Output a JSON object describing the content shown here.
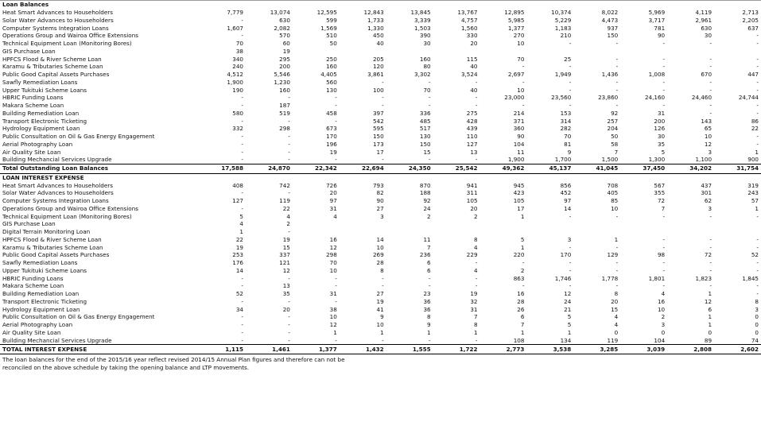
{
  "sections": [
    {
      "title": "Loan Balances",
      "rows": [
        {
          "label": "Heat Smart Advances to Householders",
          "values": [
            "7,779",
            "13,074",
            "12,595",
            "12,843",
            "13,845",
            "13,767",
            "12,895",
            "10,374",
            "8,022",
            "5,969",
            "4,119",
            "2,713"
          ]
        },
        {
          "label": "Solar Water Advances to Householders",
          "values": [
            "-",
            "630",
            "599",
            "1,733",
            "3,339",
            "4,757",
            "5,985",
            "5,229",
            "4,473",
            "3,717",
            "2,961",
            "2,205"
          ]
        },
        {
          "label": "Computer Systems Integration Loans",
          "values": [
            "1,607",
            "2,082",
            "1,569",
            "1,330",
            "1,503",
            "1,560",
            "1,377",
            "1,183",
            "937",
            "781",
            "630",
            "637"
          ]
        },
        {
          "label": "Operations Group and Wairoa Office Extensions",
          "values": [
            "-",
            "570",
            "510",
            "450",
            "390",
            "330",
            "270",
            "210",
            "150",
            "90",
            "30",
            "-"
          ]
        },
        {
          "label": "Technical Equipment Loan (Monitoring Bores)",
          "values": [
            "70",
            "60",
            "50",
            "40",
            "30",
            "20",
            "10",
            "-",
            "-",
            "-",
            "-",
            "-"
          ]
        },
        {
          "label": "GIS Purchase Loan",
          "values": [
            "38",
            "19",
            "",
            "",
            "",
            "",
            "",
            "",
            "",
            "",
            "",
            ""
          ]
        },
        {
          "label": "HPFCS Flood & River Scheme Loan",
          "values": [
            "340",
            "295",
            "250",
            "205",
            "160",
            "115",
            "70",
            "25",
            "-",
            "-",
            "-",
            "-"
          ]
        },
        {
          "label": "Karamu & Tributaries Scheme Loan",
          "values": [
            "240",
            "200",
            "160",
            "120",
            "80",
            "40",
            "-",
            "-",
            "-",
            "-",
            "-",
            "-"
          ]
        },
        {
          "label": "Public Good Capital Assets Purchases",
          "values": [
            "4,512",
            "5,546",
            "4,405",
            "3,861",
            "3,302",
            "3,524",
            "2,697",
            "1,949",
            "1,436",
            "1,008",
            "670",
            "447"
          ]
        },
        {
          "label": "Sawfly Remediation Loans",
          "values": [
            "1,900",
            "1,230",
            "560",
            "-",
            "-",
            "-",
            "-",
            "-",
            "-",
            "-",
            "-",
            "-"
          ]
        },
        {
          "label": "Upper Tukituki Scheme Loans",
          "values": [
            "190",
            "160",
            "130",
            "100",
            "70",
            "40",
            "10",
            "-",
            "-",
            "-",
            "-",
            "-"
          ]
        },
        {
          "label": "HBRIC Funding Loans",
          "values": [
            "-",
            "-",
            "-",
            "-",
            "-",
            "-",
            "23,000",
            "23,560",
            "23,860",
            "24,160",
            "24,460",
            "24,744"
          ]
        },
        {
          "label": "Makara Scheme Loan",
          "values": [
            "-",
            "187",
            "-",
            "-",
            "-",
            "-",
            "-",
            "-",
            "-",
            "-",
            "-",
            "-"
          ]
        },
        {
          "label": "Building Remediation Loan",
          "values": [
            "580",
            "519",
            "458",
            "397",
            "336",
            "275",
            "214",
            "153",
            "92",
            "31",
            "-",
            "-"
          ]
        },
        {
          "label": "Transport Electronic Ticketing",
          "values": [
            "-",
            "-",
            "-",
            "542",
            "485",
            "428",
            "371",
            "314",
            "257",
            "200",
            "143",
            "86"
          ]
        },
        {
          "label": "Hydrology Equipment Loan",
          "values": [
            "332",
            "298",
            "673",
            "595",
            "517",
            "439",
            "360",
            "282",
            "204",
            "126",
            "65",
            "22"
          ]
        },
        {
          "label": "Public Consultation on Oil & Gas Energy Engagement",
          "values": [
            "-",
            "-",
            "170",
            "150",
            "130",
            "110",
            "90",
            "70",
            "50",
            "30",
            "10",
            "-"
          ]
        },
        {
          "label": "Aerial Photography Loan",
          "values": [
            "-",
            "-",
            "196",
            "173",
            "150",
            "127",
            "104",
            "81",
            "58",
            "35",
            "12",
            "-"
          ]
        },
        {
          "label": "Air Quality Site Loan",
          "values": [
            "-",
            "-",
            "19",
            "17",
            "15",
            "13",
            "11",
            "9",
            "7",
            "5",
            "3",
            "1"
          ]
        },
        {
          "label": "Building Mechancial Services Upgrade",
          "values": [
            "-",
            "-",
            "-",
            "-",
            "-",
            "-",
            "1,900",
            "1,700",
            "1,500",
            "1,300",
            "1,100",
            "900"
          ]
        }
      ],
      "total": {
        "label": "Total Outstanding Loan Balances",
        "values": [
          "17,588",
          "24,870",
          "22,342",
          "22,694",
          "24,350",
          "25,542",
          "49,362",
          "45,137",
          "41,045",
          "37,450",
          "34,202",
          "31,754"
        ]
      }
    },
    {
      "title": "LOAN INTEREST EXPENSE",
      "rows": [
        {
          "label": "Heat Smart Advances to Householders",
          "values": [
            "408",
            "742",
            "726",
            "793",
            "870",
            "941",
            "945",
            "856",
            "708",
            "567",
            "437",
            "319"
          ]
        },
        {
          "label": "Solar Water Advances to Householders",
          "values": [
            "-",
            "-",
            "20",
            "82",
            "188",
            "311",
            "423",
            "452",
            "405",
            "355",
            "301",
            "243"
          ]
        },
        {
          "label": "Computer Systems Integration Loans",
          "values": [
            "127",
            "119",
            "97",
            "90",
            "92",
            "105",
            "105",
            "97",
            "85",
            "72",
            "62",
            "57"
          ]
        },
        {
          "label": "Operations Group and Wairoa Office Extensions",
          "values": [
            "-",
            "22",
            "31",
            "27",
            "24",
            "20",
            "17",
            "14",
            "10",
            "7",
            "3",
            "1"
          ]
        },
        {
          "label": "Technical Equipment Loan (Monitoring Bores)",
          "values": [
            "5",
            "4",
            "4",
            "3",
            "2",
            "2",
            "1",
            "-",
            "-",
            "-",
            "-",
            "-"
          ]
        },
        {
          "label": "GIS Purchase Loan",
          "values": [
            "4",
            "2",
            "",
            "",
            "",
            "",
            "",
            "",
            "",
            "",
            "",
            ""
          ]
        },
        {
          "label": "Digital Terrain Monitoring Loan",
          "values": [
            "1",
            "-",
            "",
            "",
            "",
            "",
            "",
            "",
            "",
            "",
            "",
            ""
          ]
        },
        {
          "label": "HPFCS Flood & River Scheme Loan",
          "values": [
            "22",
            "19",
            "16",
            "14",
            "11",
            "8",
            "5",
            "3",
            "1",
            "-",
            "-",
            "-"
          ]
        },
        {
          "label": "Karamu & Tributaries Scheme Loan",
          "values": [
            "19",
            "15",
            "12",
            "10",
            "7",
            "4",
            "1",
            "-",
            "-",
            "-",
            "-",
            "-"
          ]
        },
        {
          "label": "Public Good Capital Assets Purchases",
          "values": [
            "253",
            "337",
            "298",
            "269",
            "236",
            "229",
            "220",
            "170",
            "129",
            "98",
            "72",
            "52"
          ]
        },
        {
          "label": "Sawfly Remediation Loans",
          "values": [
            "176",
            "121",
            "70",
            "28",
            "6",
            "-",
            "-",
            "-",
            "-",
            "-",
            "-",
            "-"
          ]
        },
        {
          "label": "Upper Tukituki Scheme Loans",
          "values": [
            "14",
            "12",
            "10",
            "8",
            "6",
            "4",
            "2",
            "-",
            "-",
            "-",
            "-",
            "-"
          ]
        },
        {
          "label": "HBRIC Funding Loans",
          "values": [
            "-",
            "-",
            "-",
            "-",
            "-",
            "-",
            "863",
            "1,746",
            "1,778",
            "1,801",
            "1,823",
            "1,845"
          ]
        },
        {
          "label": "Makara Scheme Loan",
          "values": [
            "-",
            "13",
            "-",
            "-",
            "-",
            "-",
            "-",
            "-",
            "-",
            "-",
            "-",
            "-"
          ]
        },
        {
          "label": "Building Remediation Loan",
          "values": [
            "52",
            "35",
            "31",
            "27",
            "23",
            "19",
            "16",
            "12",
            "8",
            "4",
            "1",
            "-"
          ]
        },
        {
          "label": "Transport Electronic Ticketing",
          "values": [
            "-",
            "-",
            "-",
            "19",
            "36",
            "32",
            "28",
            "24",
            "20",
            "16",
            "12",
            "8"
          ]
        },
        {
          "label": "Hydrology Equipment Loan",
          "values": [
            "34",
            "20",
            "38",
            "41",
            "36",
            "31",
            "26",
            "21",
            "15",
            "10",
            "6",
            "3"
          ]
        },
        {
          "label": "Public Consultation on Oil & Gas Energy Engagement",
          "values": [
            "-",
            "-",
            "10",
            "9",
            "8",
            "7",
            "6",
            "5",
            "4",
            "2",
            "1",
            "0"
          ]
        },
        {
          "label": "Aerial Photography Loan",
          "values": [
            "-",
            "-",
            "12",
            "10",
            "9",
            "8",
            "7",
            "5",
            "4",
            "3",
            "1",
            "0"
          ]
        },
        {
          "label": "Air Quality Site Loan",
          "values": [
            "-",
            "-",
            "1",
            "1",
            "1",
            "1",
            "1",
            "1",
            "0",
            "0",
            "0",
            "0"
          ]
        },
        {
          "label": "Building Mechancial Services Upgrade",
          "values": [
            "-",
            "-",
            "-",
            "-",
            "-",
            "-",
            "108",
            "134",
            "119",
            "104",
            "89",
            "74"
          ]
        }
      ],
      "total": {
        "label": "TOTAL INTEREST EXPENSE",
        "values": [
          "1,115",
          "1,461",
          "1,377",
          "1,432",
          "1,555",
          "1,722",
          "2,773",
          "3,538",
          "3,285",
          "3,039",
          "2,808",
          "2,602"
        ]
      }
    }
  ],
  "notes": [
    "The loan balances for the end of the 2015/16 year reflect revised 2014/15 Annual Plan figures and therefore can not be",
    "reconciled on the above schedule by taking the opening balance and LTP movements."
  ]
}
